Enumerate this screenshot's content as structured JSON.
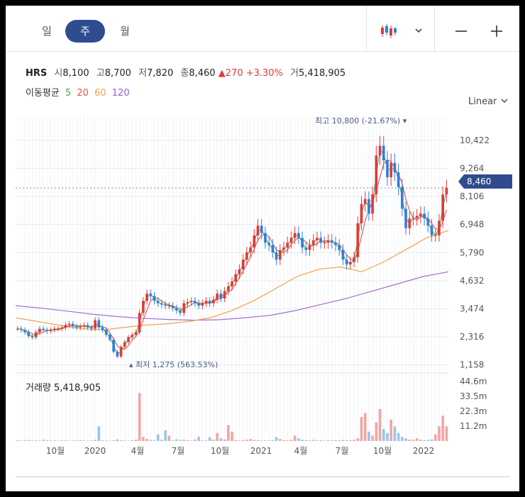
{
  "toolbar": {
    "periods": [
      "일",
      "주",
      "월"
    ],
    "active_period": "주",
    "chart_type_icon": "candlestick-icon",
    "dropdown_icon": "chevron-down-icon",
    "zoom_out_label": "—",
    "zoom_in_label": "+"
  },
  "info": {
    "symbol": "HRS",
    "open_label": "시",
    "open": "8,100",
    "high_label": "고",
    "high": "8,700",
    "low_label": "저",
    "low": "7,820",
    "close_label": "종",
    "close": "8,460",
    "change_arrow": "▲",
    "change": "270",
    "change_pct": "+3.30%",
    "volume_label": "거",
    "volume": "5,418,905"
  },
  "moving_average": {
    "label": "이동평균",
    "periods": [
      {
        "value": "5",
        "color": "#3cb043"
      },
      {
        "value": "20",
        "color": "#e2554f"
      },
      {
        "value": "60",
        "color": "#f0a24a"
      },
      {
        "value": "120",
        "color": "#9b59d0"
      }
    ]
  },
  "scale_label": "Linear",
  "colors": {
    "up": "#e03a3a",
    "down": "#2f7fd9",
    "accent": "#2f4c8f",
    "vol_up": "#f2a5a5",
    "vol_down": "#9cc3ec"
  },
  "chart_data": {
    "type": "candlestick",
    "title": "",
    "y_ticks": [
      "10,422",
      "9,264",
      "8,106",
      "6,948",
      "5,790",
      "4,632",
      "3,474",
      "2,316",
      "1,158"
    ],
    "y_tick_values": [
      10422,
      9264,
      8106,
      6948,
      5790,
      4632,
      3474,
      2316,
      1158
    ],
    "ylim": [
      1000,
      11300
    ],
    "x_ticks": [
      "10월",
      "2020",
      "4월",
      "7월",
      "10월",
      "2021",
      "4월",
      "7월",
      "10월",
      "2022"
    ],
    "current_price": "8,460",
    "high_annotation": "최고 10,800 (-21.67%) ▾",
    "low_annotation": "▴ 최저 1,275 (563.53%)",
    "volume_label": "거래량 5,418,905",
    "volume_ticks": [
      "44.6m",
      "33.5m",
      "22.3m",
      "11.2m"
    ],
    "volume_tick_values": [
      44.6,
      33.5,
      22.3,
      11.2
    ],
    "weekly_close": [
      2650,
      2600,
      2500,
      2350,
      2300,
      2500,
      2650,
      2600,
      2550,
      2600,
      2650,
      2650,
      2700,
      2800,
      2850,
      2750,
      2700,
      2750,
      2800,
      2700,
      2650,
      3000,
      2700,
      2600,
      2400,
      2200,
      1700,
      1500,
      1900,
      2100,
      2300,
      2400,
      2500,
      3300,
      3800,
      4100,
      4000,
      3800,
      3700,
      3650,
      3600,
      3600,
      3500,
      3400,
      3300,
      3700,
      3750,
      3800,
      3700,
      3600,
      3700,
      3800,
      3700,
      3850,
      4100,
      3900,
      4200,
      4400,
      4600,
      4900,
      5100,
      5500,
      5800,
      6000,
      6500,
      6900,
      6600,
      6200,
      6100,
      5800,
      5500,
      5900,
      6000,
      6200,
      6400,
      6600,
      6400,
      6000,
      5900,
      6100,
      6300,
      6400,
      6200,
      6200,
      6300,
      6200,
      6100,
      5900,
      5500,
      5300,
      5400,
      5600,
      7000,
      7800,
      8000,
      7400,
      8200,
      9800,
      10200,
      9600,
      8900,
      9500,
      9100,
      8500,
      7600,
      6800,
      7200,
      7200,
      7300,
      7400,
      7200,
      6900,
      6500,
      6500,
      7100,
      8190,
      8460
    ],
    "volume_m": [
      0.5,
      0.4,
      0.6,
      0.8,
      0.5,
      0.4,
      0.3,
      1.0,
      0.5,
      0.4,
      0.4,
      0.3,
      0.5,
      0.4,
      0.3,
      0.3,
      0.5,
      0.6,
      0.4,
      0.3,
      0.4,
      0.9,
      11,
      0.5,
      0.4,
      0.3,
      0.6,
      1.2,
      0.5,
      0.4,
      0.3,
      0.6,
      1.0,
      36,
      3.0,
      1.5,
      0.8,
      0.6,
      5,
      1.0,
      8,
      4,
      0.5,
      1.2,
      0.8,
      1.0,
      0.5,
      0.4,
      1.1,
      3.2,
      0.6,
      0.4,
      2.8,
      1.0,
      6,
      2.0,
      1.2,
      12,
      7,
      0.8,
      0.4,
      0.6,
      1.0,
      1.5,
      0.8,
      0.6,
      0.4,
      0.5,
      0.4,
      0.5,
      3,
      1.5,
      0.6,
      0.5,
      0.8,
      4,
      2.0,
      1.0,
      0.6,
      0.5,
      0.9,
      0.5,
      0.6,
      0.4,
      0.5,
      0.5,
      0.6,
      0.5,
      0.8,
      0.6,
      0.5,
      1.0,
      2,
      18,
      21,
      7,
      4,
      14,
      24,
      9,
      6,
      16,
      11,
      6,
      3,
      2,
      1,
      1,
      2,
      1,
      0.6,
      0.8,
      1.2,
      5,
      11,
      19,
      11
    ],
    "ma120": [
      3600,
      3500,
      3380,
      3250,
      3150,
      3080,
      3030,
      3000,
      3020,
      3100,
      3200,
      3400,
      3650,
      3900,
      4200,
      4500,
      4800,
      5000
    ],
    "ma60": [
      3100,
      2950,
      2800,
      2650,
      2600,
      2700,
      2800,
      2850,
      2950,
      3100,
      3400,
      3800,
      4300,
      4800,
      5100,
      5200,
      5000,
      5400,
      5900,
      6400,
      6700
    ]
  }
}
